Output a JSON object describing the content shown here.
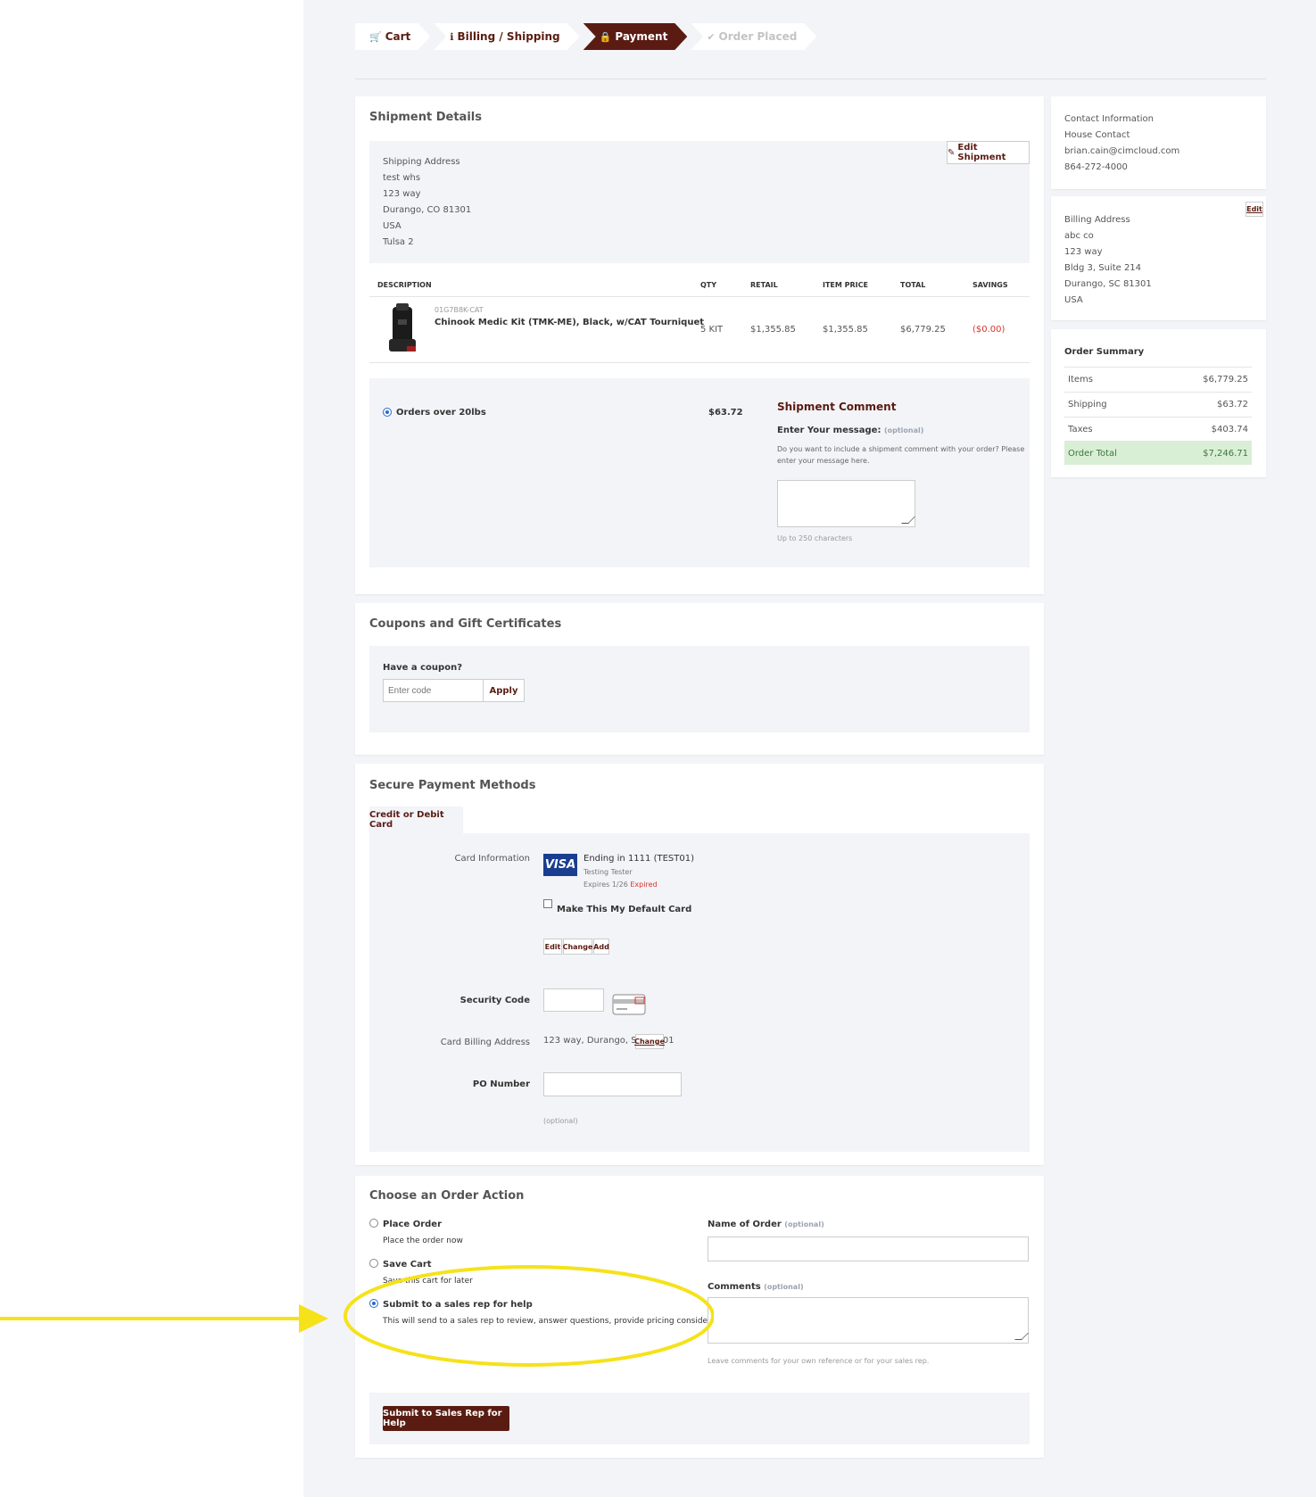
{
  "steps": [
    {
      "label": "Cart",
      "icon": "cart-icon",
      "glyph": "🛒"
    },
    {
      "label": "Billing / Shipping",
      "icon": "info-icon",
      "glyph": "ℹ"
    },
    {
      "label": "Payment",
      "icon": "lock-icon",
      "glyph": "🔒"
    },
    {
      "label": "Order Placed",
      "icon": "check-icon",
      "glyph": "✔"
    }
  ],
  "shipment": {
    "title": "Shipment Details",
    "address_label": "Shipping Address",
    "address_lines": [
      "test whs",
      "123 way",
      "Durango, CO 81301",
      "USA",
      "Tulsa 2"
    ],
    "edit_button": "Edit Shipment",
    "columns": [
      "DESCRIPTION",
      "QTY",
      "RETAIL",
      "ITEM PRICE",
      "TOTAL",
      "SAVINGS"
    ],
    "item": {
      "sku": "01G7B8K-CAT",
      "name": "Chinook Medic Kit (TMK-ME), Black, w/CAT Tourniquet",
      "qty": "5 KIT",
      "retail": "$1,355.85",
      "item_price": "$1,355.85",
      "total": "$6,779.25",
      "savings": "($0.00)"
    },
    "method_label": "Orders over 20lbs",
    "method_price": "$63.72",
    "comment_title": "Shipment Comment",
    "comment_prompt": "Enter Your message:",
    "comment_optional": "(optional)",
    "comment_help_1": "Do you want to include a shipment comment with your order? Please",
    "comment_help_2": "enter your message here.",
    "comment_limit": "Up to 250 characters"
  },
  "contact": {
    "title": "Contact Information",
    "lines": [
      "House Contact",
      "brian.cain@cimcloud.com",
      "864-272-4000"
    ]
  },
  "billing": {
    "title": "Billing Address",
    "edit": "Edit",
    "lines": [
      "abc co",
      "123 way",
      "Bldg 3, Suite 214",
      "Durango, SC 81301",
      "USA"
    ]
  },
  "summary": {
    "title": "Order Summary",
    "rows": [
      {
        "label": "Items",
        "value": "$6,779.25"
      },
      {
        "label": "Shipping",
        "value": "$63.72"
      },
      {
        "label": "Taxes",
        "value": "$403.74"
      }
    ],
    "total_label": "Order Total",
    "total_value": "$7,246.71"
  },
  "coupons": {
    "title": "Coupons and Gift Certificates",
    "prompt": "Have a coupon?",
    "placeholder": "Enter code",
    "apply": "Apply"
  },
  "payment": {
    "title": "Secure Payment Methods",
    "tab": "Credit or Debit Card",
    "card_info_label": "Card Information",
    "card_brand": "VISA",
    "card_ending": "Ending in 1111 (TEST01)",
    "card_holder": "Testing Tester",
    "card_expires": "Expires 1/26",
    "card_expired": "Expired",
    "default_label": "Make This My Default Card",
    "edit": "Edit",
    "change": "Change",
    "add": "Add",
    "security_label": "Security Code",
    "billing_addr_label": "Card Billing Address",
    "billing_addr_value": "123 way, Durango, SC 81301",
    "billing_change": "Change",
    "po_label": "PO Number",
    "po_optional": "(optional)"
  },
  "order_action": {
    "title": "Choose an Order Action",
    "options": [
      {
        "label": "Place Order",
        "desc": "Place the order now",
        "selected": false
      },
      {
        "label": "Save Cart",
        "desc": "Save this cart for later",
        "selected": false
      },
      {
        "label": "Submit to a sales rep for help",
        "desc": "This will send to a sales rep to review, answer questions, provide pricing consideration, etc",
        "selected": true
      }
    ],
    "name_label": "Name of Order",
    "name_optional": "(optional)",
    "comments_label": "Comments",
    "comments_optional": "(optional)",
    "comments_help": "Leave comments for your own reference or for your sales rep.",
    "submit": "Submit to Sales Rep for Help"
  },
  "colors": {
    "brand": "#5a1c12",
    "highlight": "#f5e21a",
    "total_bg": "#d9efd5"
  }
}
